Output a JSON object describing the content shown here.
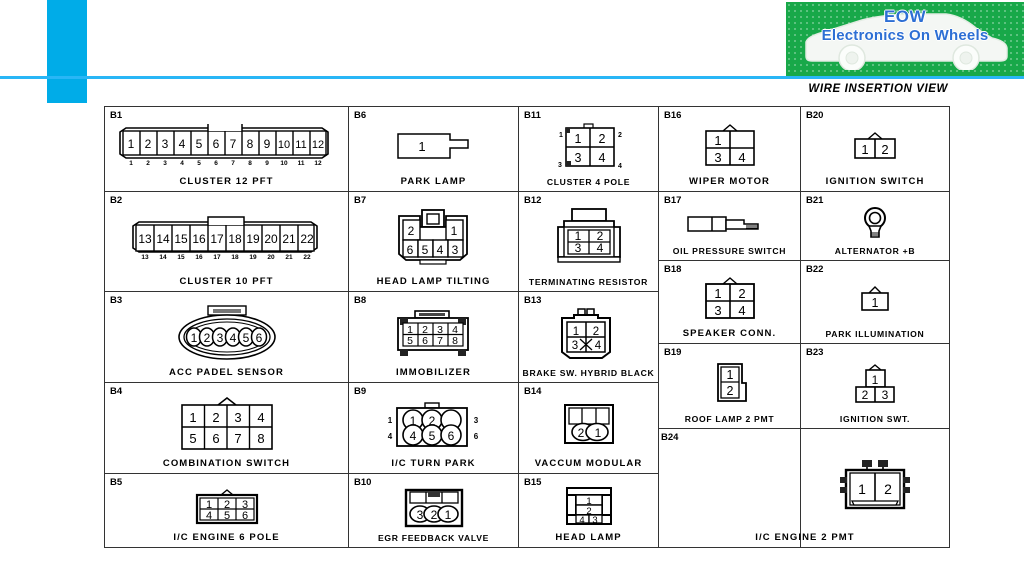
{
  "header": {
    "logo": {
      "line1": "EOW",
      "line2": "Electronics On Wheels",
      "bg_color": "#18a849",
      "text_color": "#2d6fd4",
      "icon": "car-silhouette-icon"
    },
    "accent_color": "#00ace8",
    "title": "WIRE INSERTION VIEW"
  },
  "connectors": [
    {
      "id": "B1",
      "name": "CLUSTER 12 PFT",
      "type": "inline-strip",
      "pins": [
        "1",
        "2",
        "3",
        "4",
        "5",
        "6",
        "7",
        "8",
        "9",
        "10",
        "11",
        "12"
      ],
      "sub_labels": [
        "1",
        "2",
        "3",
        "4",
        "5",
        "6",
        "7",
        "8",
        "9",
        "10",
        "11",
        "12"
      ]
    },
    {
      "id": "B2",
      "name": "CLUSTER 10 PFT",
      "type": "inline-strip",
      "pins": [
        "13",
        "14",
        "15",
        "16",
        "17",
        "18",
        "19",
        "20",
        "21",
        "22"
      ],
      "sub_labels": [
        "13",
        "14",
        "15",
        "16",
        "17",
        "18",
        "19",
        "20",
        "21",
        "22"
      ]
    },
    {
      "id": "B3",
      "name": "ACC PADEL SENSOR",
      "type": "oval-6",
      "pins": [
        "1",
        "2",
        "3",
        "4",
        "5",
        "6"
      ]
    },
    {
      "id": "B4",
      "name": "COMBINATION SWITCH",
      "type": "grid-4x2",
      "rows": [
        [
          "1",
          "2",
          "3",
          "4"
        ],
        [
          "5",
          "6",
          "7",
          "8"
        ]
      ]
    },
    {
      "id": "B5",
      "name": "I/C ENGINE 6 POLE",
      "type": "grid-3x2",
      "rows": [
        [
          "1",
          "2",
          "3"
        ],
        [
          "4",
          "5",
          "6"
        ]
      ]
    },
    {
      "id": "B6",
      "name": "PARK LAMP",
      "type": "single-tab",
      "pins": [
        "1"
      ]
    },
    {
      "id": "B7",
      "name": "HEAD LAMP TILTING",
      "type": "headlamp-6",
      "top_row": [
        "2",
        "1"
      ],
      "bottom_row": [
        "6",
        "5",
        "4",
        "3"
      ]
    },
    {
      "id": "B8",
      "name": "IMMOBILIZER",
      "type": "grid-4x2-small",
      "rows": [
        [
          "1",
          "2",
          "3",
          "4"
        ],
        [
          "5",
          "6",
          "7",
          "8"
        ]
      ]
    },
    {
      "id": "B9",
      "name": "I/C TURN PARK",
      "type": "circles-3x2",
      "rows": [
        [
          "1",
          "2",
          ""
        ],
        [
          "4",
          "5",
          "6"
        ]
      ],
      "side_labels": [
        "1",
        "3",
        "4",
        "6"
      ]
    },
    {
      "id": "B10",
      "name": "EGR FEEDBACK VALVE",
      "type": "egr-3",
      "pins": [
        "3",
        "2",
        "1"
      ]
    },
    {
      "id": "B11",
      "name": "CLUSTER 4 POLE",
      "type": "grid-2x2",
      "rows": [
        [
          "1",
          "2"
        ],
        [
          "3",
          "4"
        ]
      ]
    },
    {
      "id": "B12",
      "name": "TERMINATING RESISTOR",
      "type": "resistor-4",
      "rows": [
        [
          "1",
          "2"
        ],
        [
          "3",
          "4"
        ]
      ]
    },
    {
      "id": "B13",
      "name": "BRAKE SW. HYBRID BLACK",
      "type": "brake-4",
      "rows": [
        [
          "1",
          "2"
        ],
        [
          "3",
          "4"
        ]
      ]
    },
    {
      "id": "B14",
      "name": "VACCUM MODULAR",
      "type": "vaccum-2",
      "pins": [
        "2",
        "1"
      ]
    },
    {
      "id": "B15",
      "name": "HEAD LAMP",
      "type": "headlamp-3",
      "pins": [
        "1",
        "2",
        "4",
        "3"
      ]
    },
    {
      "id": "B16",
      "name": "WIPER MOTOR",
      "type": "grid-2x2-notch",
      "rows": [
        [
          "1",
          ""
        ],
        [
          "3",
          "4"
        ]
      ]
    },
    {
      "id": "B17",
      "name": "OIL PRESSURE SWITCH",
      "type": "oil-switch",
      "pins": []
    },
    {
      "id": "B18",
      "name": "SPEAKER CONN.",
      "type": "grid-2x2-notch",
      "rows": [
        [
          "1",
          "2"
        ],
        [
          "3",
          "4"
        ]
      ]
    },
    {
      "id": "B19",
      "name": "ROOF LAMP 2 PMT",
      "type": "vert-2",
      "rows": [
        [
          "1"
        ],
        [
          "2"
        ]
      ]
    },
    {
      "id": "B20",
      "name": "IGNITION SWITCH",
      "type": "horiz-2-notch",
      "pins": [
        "1",
        "2"
      ]
    },
    {
      "id": "B21",
      "name": "ALTERNATOR +B",
      "type": "ring-terminal",
      "pins": []
    },
    {
      "id": "B22",
      "name": "PARK ILLUMINATION",
      "type": "single-notch",
      "pins": [
        "1"
      ]
    },
    {
      "id": "B23",
      "name": "IGNITION SWT.",
      "type": "tri-3",
      "top": [
        "1"
      ],
      "bottom": [
        "2",
        "3"
      ]
    },
    {
      "id": "B24",
      "name": "I/C ENGINE 2 PMT",
      "type": "big-2",
      "pins": [
        "1",
        "2"
      ]
    }
  ]
}
